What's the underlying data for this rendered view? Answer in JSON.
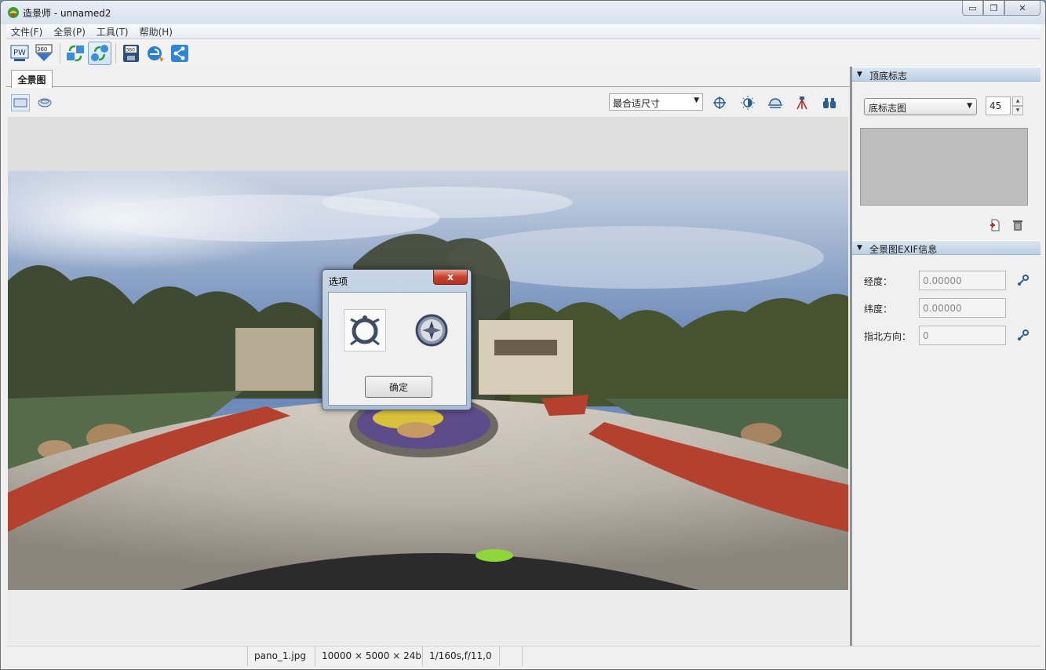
{
  "window": {
    "title": "造景师 - unnamed2",
    "minimize_glyph": "▭",
    "maximize_glyph": "❐",
    "close_glyph": "✕"
  },
  "menu": {
    "items": [
      "文件(F)",
      "全景(P)",
      "工具(T)",
      "帮助(H)"
    ]
  },
  "toolbar": {
    "buttons": [
      {
        "icon": "pw-icon",
        "label": "PW"
      },
      {
        "icon": "360-export-icon",
        "label": "360"
      },
      {
        "icon": "sync-icon"
      },
      {
        "icon": "network-sync-icon"
      },
      {
        "icon": "save-360-icon",
        "label": "360"
      },
      {
        "icon": "browser-preview-icon"
      },
      {
        "icon": "share-icon"
      }
    ]
  },
  "viewer": {
    "tab_label": "全景图",
    "zoom_select": "最合适尺寸",
    "tool_icons": [
      "crosshair-icon",
      "brightness-icon",
      "horizon-icon",
      "tripod-icon",
      "binoculars-icon"
    ]
  },
  "right_panel": {
    "section1_title": "顶底标志",
    "marker_type": "底标志图",
    "marker_size": "45",
    "section2_title": "全景图EXIF信息",
    "longitude_label": "经度：",
    "longitude_value": "0.00000",
    "latitude_label": "纬度：",
    "latitude_value": "0.00000",
    "north_label": "指北方向：",
    "north_value": "0"
  },
  "status": {
    "filename": "pano_1.jpg",
    "dimensions": "10000 × 5000 × 24b",
    "exposure": "1/160s,f/11,0"
  },
  "dialog": {
    "title": "选项",
    "close_glyph": "x",
    "ok_label": "确定"
  },
  "colors": {
    "title_bar": "#d7e1ec",
    "section_header": "#bcd0e4",
    "dialog_close": "#c7432d",
    "brick_path": "#b4402e",
    "sky": "#5e7fb3"
  }
}
